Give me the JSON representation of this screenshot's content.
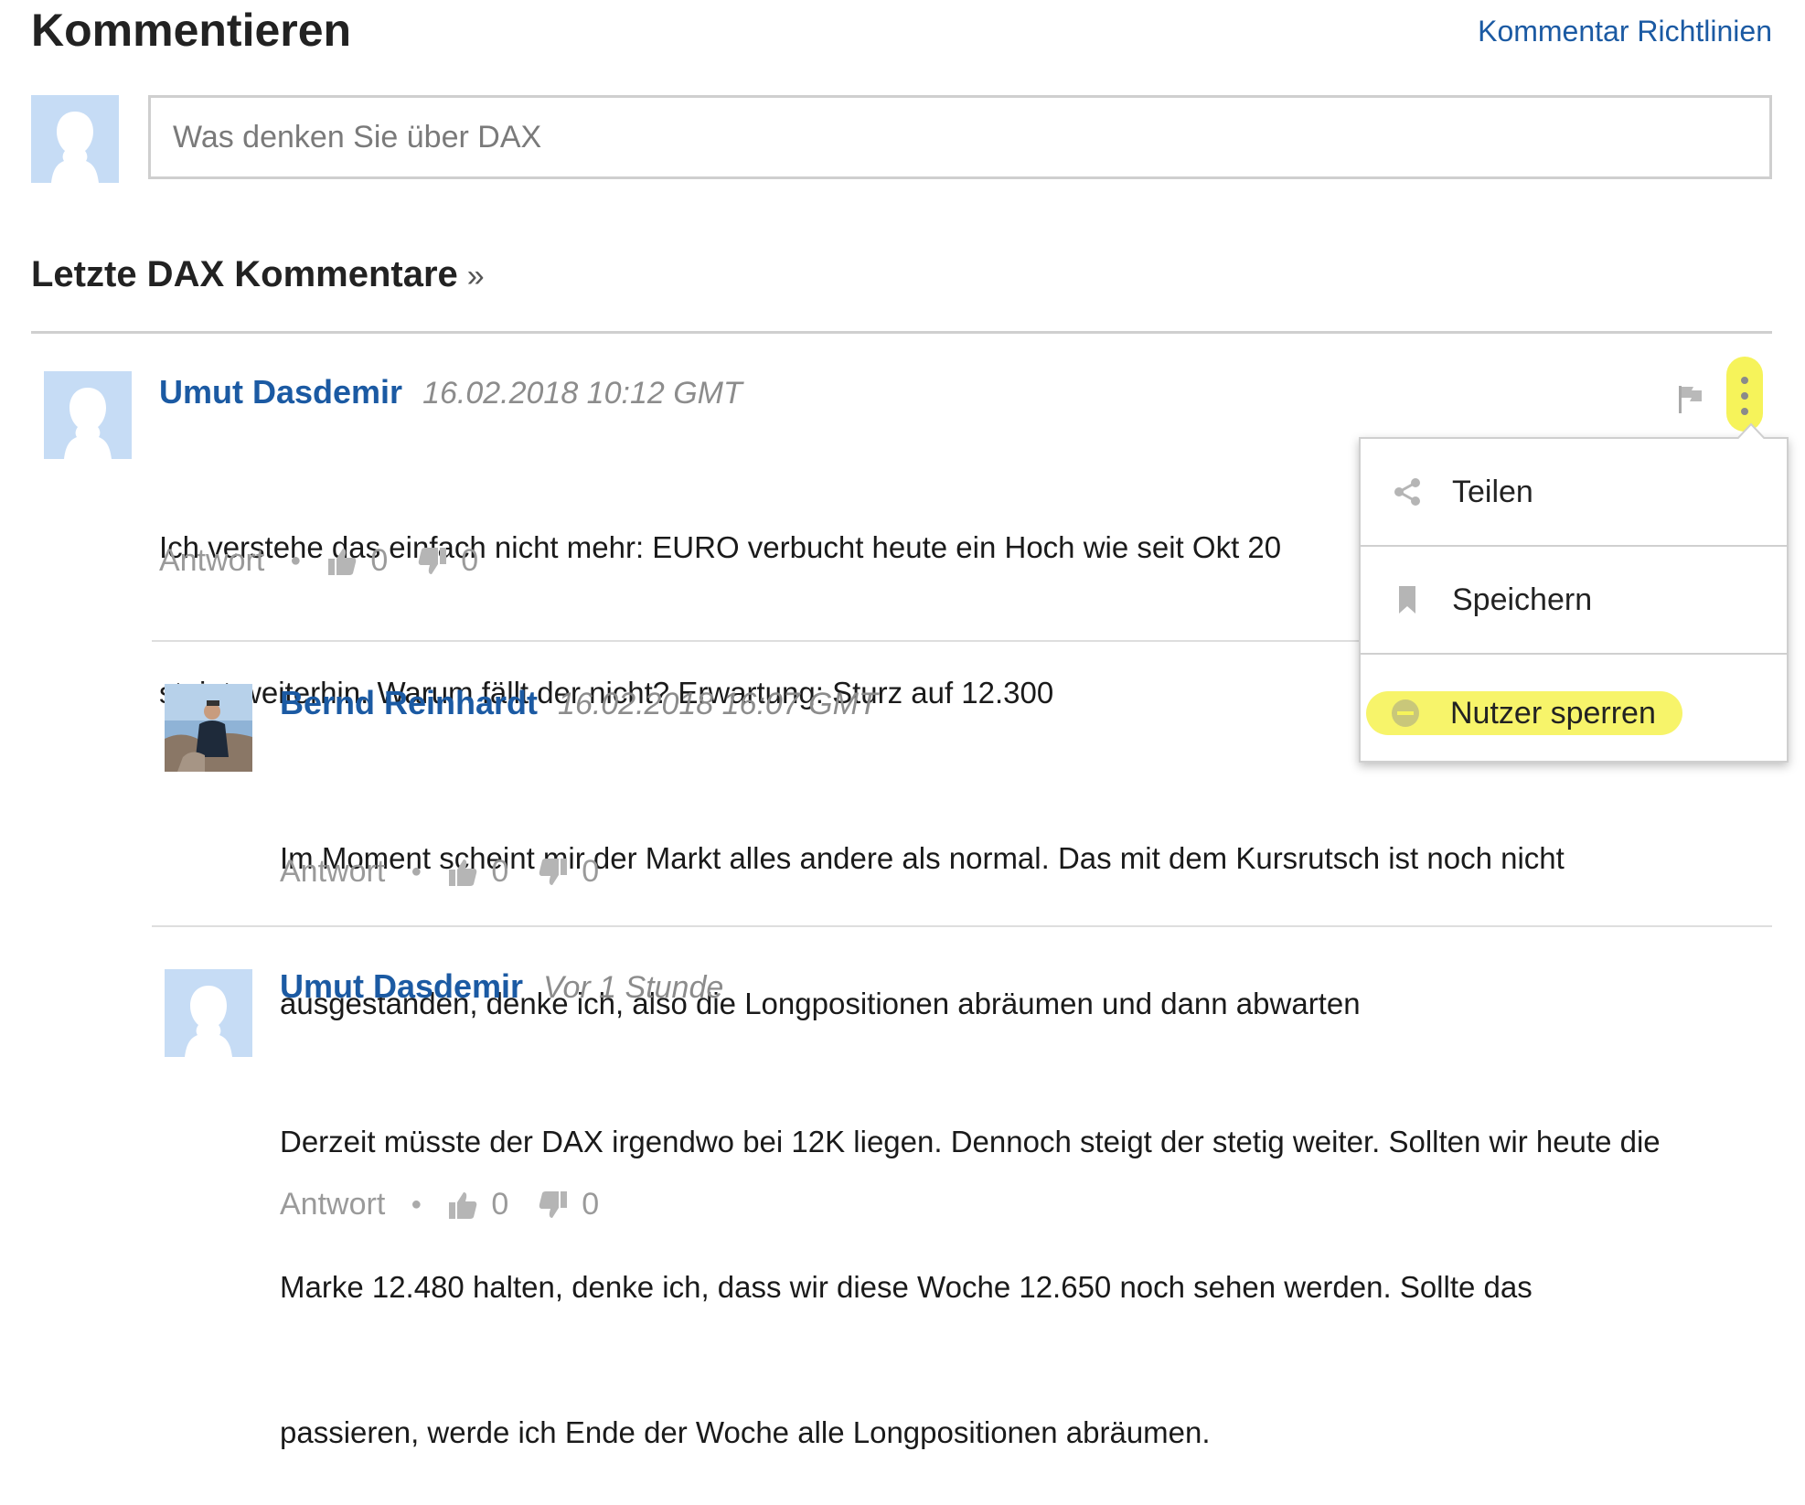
{
  "header": {
    "title": "Kommentieren",
    "guidelines_link": "Kommentar Richtlinien"
  },
  "compose": {
    "placeholder": "Was denken Sie über DAX"
  },
  "recent": {
    "heading": "Letzte DAX Kommentare",
    "arrow": "»"
  },
  "comments": [
    {
      "author": "Umut Dasdemir",
      "time": "16.02.2018 10:12 GMT",
      "text_line1": "Ich verstehe das einfach nicht mehr: EURO verbucht heute ein Hoch wie seit Okt 20",
      "text_line2": "steigt weiterhin. Warum fällt der nicht? Erwartung: Sturz auf 12.300",
      "reply": "Antwort",
      "likes": "0",
      "dislikes": "0"
    },
    {
      "author": "Bernd Reinhardt",
      "time": "16.02.2018 16:07 GMT",
      "text_line1": "Im Moment scheint mir der Markt alles andere als normal. Das mit dem Kursrutsch ist noch nicht",
      "text_line2": "ausgestanden, denke ich, also die Longpositionen abräumen und dann abwarten",
      "reply": "Antwort",
      "likes": "0",
      "dislikes": "0"
    },
    {
      "author": "Umut Dasdemir",
      "time": "Vor 1 Stunde",
      "text_line1": "Derzeit müsste der DAX irgendwo bei 12K liegen. Dennoch steigt der stetig weiter. Sollten wir heute die",
      "text_line2": "Marke 12.480 halten, denke ich, dass wir diese Woche 12.650 noch sehen werden. Sollte das",
      "text_line3": "passieren, werde ich Ende der Woche alle Longpositionen abräumen.",
      "reply": "Antwort",
      "likes": "0",
      "dislikes": "0"
    }
  ],
  "context_menu": {
    "items": [
      {
        "label": "Teilen",
        "icon": "share-icon"
      },
      {
        "label": "Speichern",
        "icon": "bookmark-icon"
      },
      {
        "label": "Nutzer sperren",
        "icon": "block-icon"
      }
    ]
  },
  "colors": {
    "link_blue": "#1b5aa3",
    "highlight_yellow": "#f6f35a",
    "avatar_bg": "#c6dcf5"
  }
}
